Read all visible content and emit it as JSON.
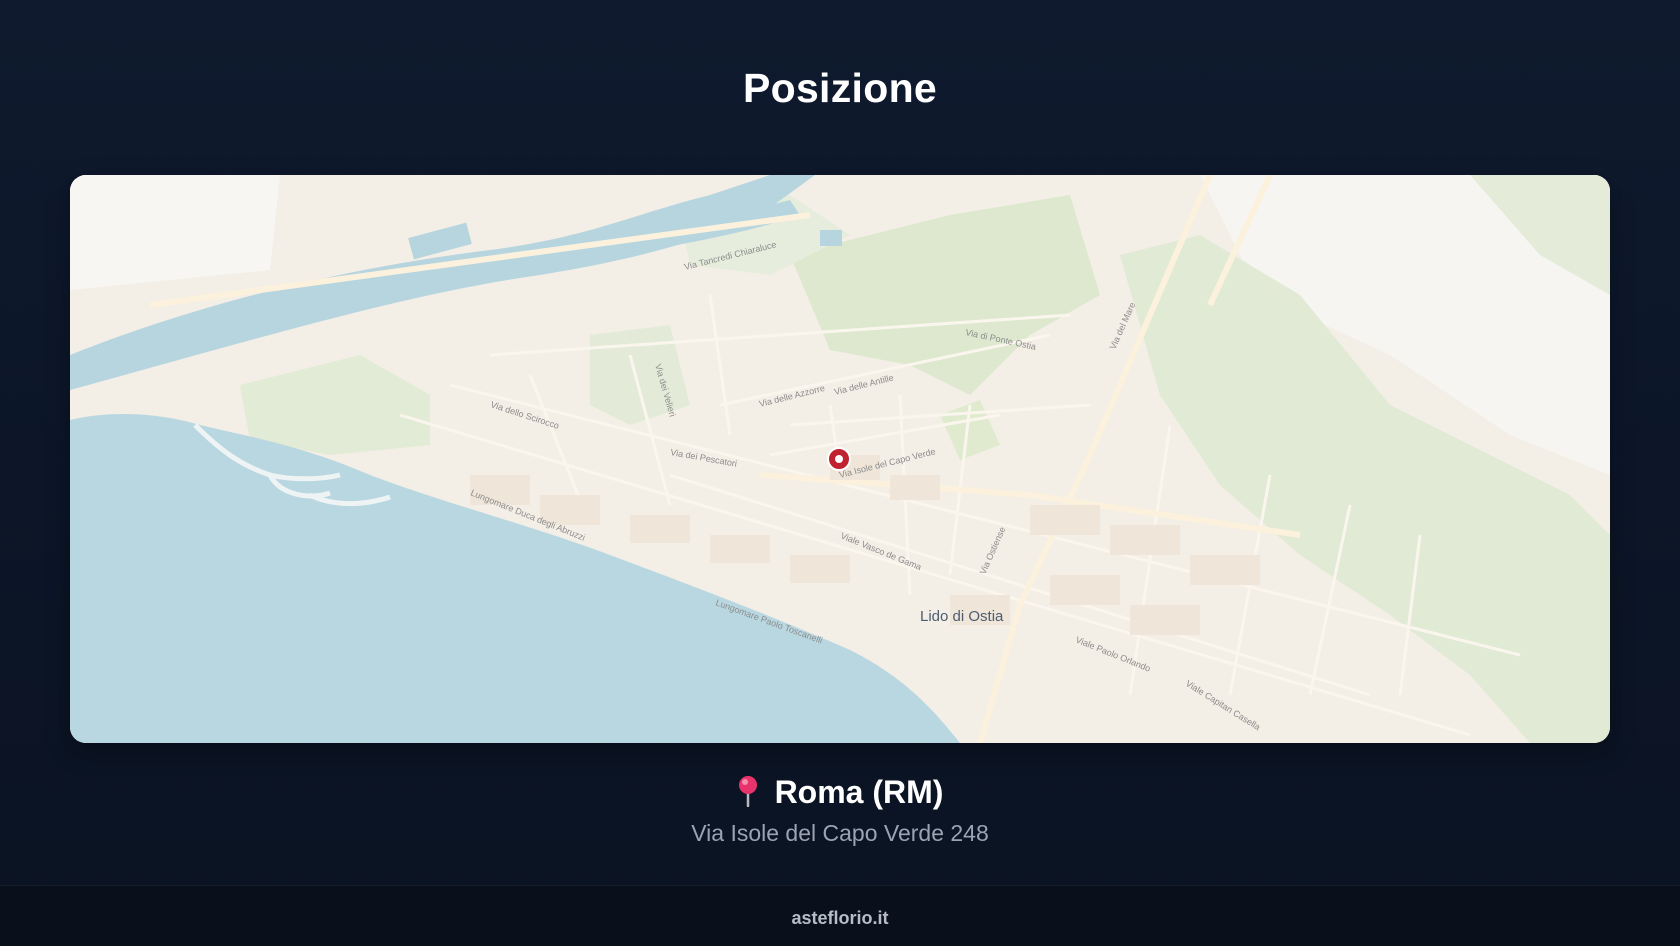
{
  "section": {
    "title": "Posizione"
  },
  "map": {
    "place_label": "Lido di Ostia",
    "street_labels": [
      "Via Isole del Capo Verde",
      "Via dello Scirocco",
      "Via delle Azzorre",
      "Via delle Antille",
      "Via di Ponte Ostia",
      "Via dei Velieri",
      "Via dei Pescatori",
      "Lungomare Duca degli Abruzzi",
      "Lungomare Paolo Toscanelli",
      "Viale Vasco de Gama",
      "Via del Mare",
      "Via Ostiense",
      "Viale Paolo Orlando",
      "Viale Capitan Casella",
      "Via Tancredi Chiaraluce"
    ],
    "marker_color": "#c0232f"
  },
  "location": {
    "icon": "pushpin-icon",
    "city": "Roma (RM)",
    "address": "Via Isole del Capo Verde 248"
  },
  "footer": {
    "site": "asteflorio.it"
  }
}
